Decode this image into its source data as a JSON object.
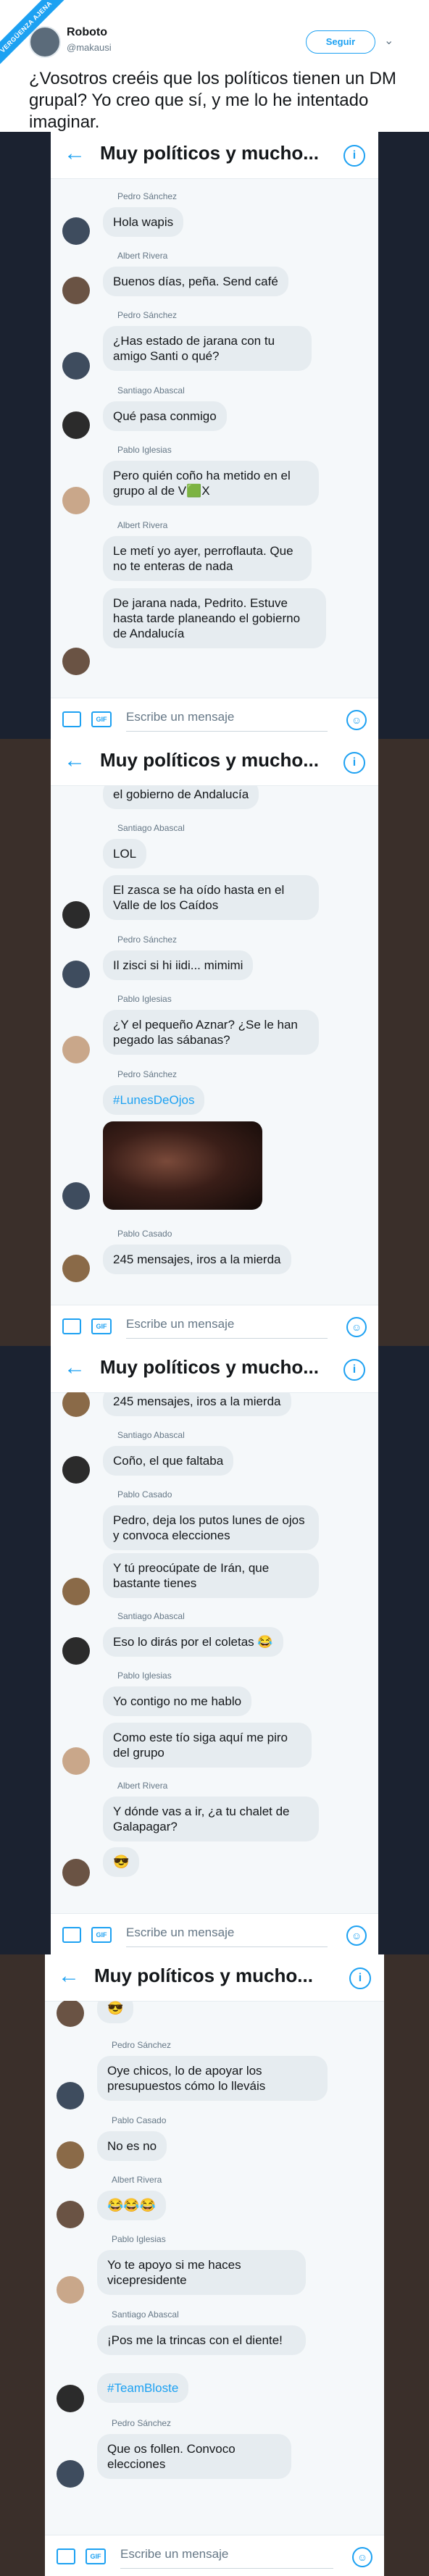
{
  "badge": "VERGÜENZA AJENA",
  "tweet": {
    "author": "Roboto",
    "handle": "@makausi",
    "follow_label": "Seguir",
    "more_icon": "chevron-down-icon",
    "text": "¿Vosotros creéis que los políticos tienen un DM grupal? Yo creo que sí, y me lo he intentado imaginar."
  },
  "colors": {
    "accent": "#1da1f2",
    "bubble": "#e6ecf0",
    "frame_dark": "#3a2f2a",
    "frame_navy": "#1b2230"
  },
  "chat_title": "Muy políticos y mucho...",
  "input_placeholder": "Escribe un mensaje",
  "gif_label": "GIF",
  "screens": [
    {
      "messages": [
        {
          "sender": "Pedro Sánchez",
          "texts": [
            "Hola wapis"
          ]
        },
        {
          "sender": "Albert Rivera",
          "texts": [
            "Buenos días, peña. Send café"
          ]
        },
        {
          "sender": "Pedro Sánchez",
          "texts": [
            "¿Has estado de jarana con tu amigo Santi o qué?"
          ]
        },
        {
          "sender": "Santiago Abascal",
          "texts": [
            "Qué pasa conmigo"
          ]
        },
        {
          "sender": "Pablo Iglesias",
          "texts": [
            "Pero quién coño ha metido en el grupo al de V🟩X"
          ]
        },
        {
          "sender": "Albert Rivera",
          "texts": [
            "Le metí yo ayer, perroflauta. Que no te enteras de nada",
            "De jarana nada, Pedrito. Estuve hasta tarde planeando el gobierno de Andalucía"
          ]
        }
      ]
    },
    {
      "messages": [
        {
          "sender": "",
          "texts": [
            "el gobierno de Andalucía"
          ]
        },
        {
          "sender": "Santiago Abascal",
          "texts": [
            "LOL",
            "El zasca se ha oído hasta en el Valle de los Caídos"
          ]
        },
        {
          "sender": "Pedro Sánchez",
          "texts": [
            "Il zisci si hi iidi... mimimi"
          ]
        },
        {
          "sender": "Pablo Iglesias",
          "texts": [
            "¿Y el pequeño Aznar? ¿Se le han pegado las sábanas?"
          ]
        },
        {
          "sender": "Pedro Sánchez",
          "texts": [
            "#LunesDeOjos"
          ],
          "image": "close-up-eyes-photo"
        },
        {
          "sender": "Pablo Casado",
          "texts": [
            "245 mensajes, iros a la mierda"
          ]
        }
      ]
    },
    {
      "messages": [
        {
          "sender": "",
          "texts": [
            "245 mensajes, iros a la mierda"
          ]
        },
        {
          "sender": "Santiago Abascal",
          "texts": [
            "Coño, el que faltaba"
          ]
        },
        {
          "sender": "Pablo Casado",
          "texts": [
            "Pedro, deja los putos lunes de ojos y convoca elecciones",
            "Y tú preocúpate de Irán, que bastante tienes"
          ]
        },
        {
          "sender": "Santiago Abascal",
          "texts": [
            "Eso lo dirás por el coletas 😂"
          ]
        },
        {
          "sender": "Pablo Iglesias",
          "texts": [
            "Yo contigo no me hablo",
            "Como este tío siga aquí me piro del grupo"
          ]
        },
        {
          "sender": "Albert Rivera",
          "texts": [
            "Y dónde vas a ir, ¿a tu chalet de Galapagar?",
            "😎"
          ]
        }
      ]
    },
    {
      "messages": [
        {
          "sender": "",
          "texts": [
            "😎"
          ]
        },
        {
          "sender": "Pedro Sánchez",
          "texts": [
            "Oye chicos, lo de apoyar los presupuestos cómo lo lleváis"
          ]
        },
        {
          "sender": "Pablo Casado",
          "texts": [
            "No es no"
          ]
        },
        {
          "sender": "Albert Rivera",
          "texts": [
            "😂😂😂"
          ]
        },
        {
          "sender": "Pablo Iglesias",
          "texts": [
            "Yo te apoyo si me haces vicepresidente"
          ]
        },
        {
          "sender": "Santiago Abascal",
          "texts": [
            "¡Pos me la trincas con el diente!",
            "#TeamBloste"
          ]
        },
        {
          "sender": "Pedro Sánchez",
          "texts": [
            "Que os follen. Convoco elecciones"
          ]
        }
      ]
    }
  ]
}
